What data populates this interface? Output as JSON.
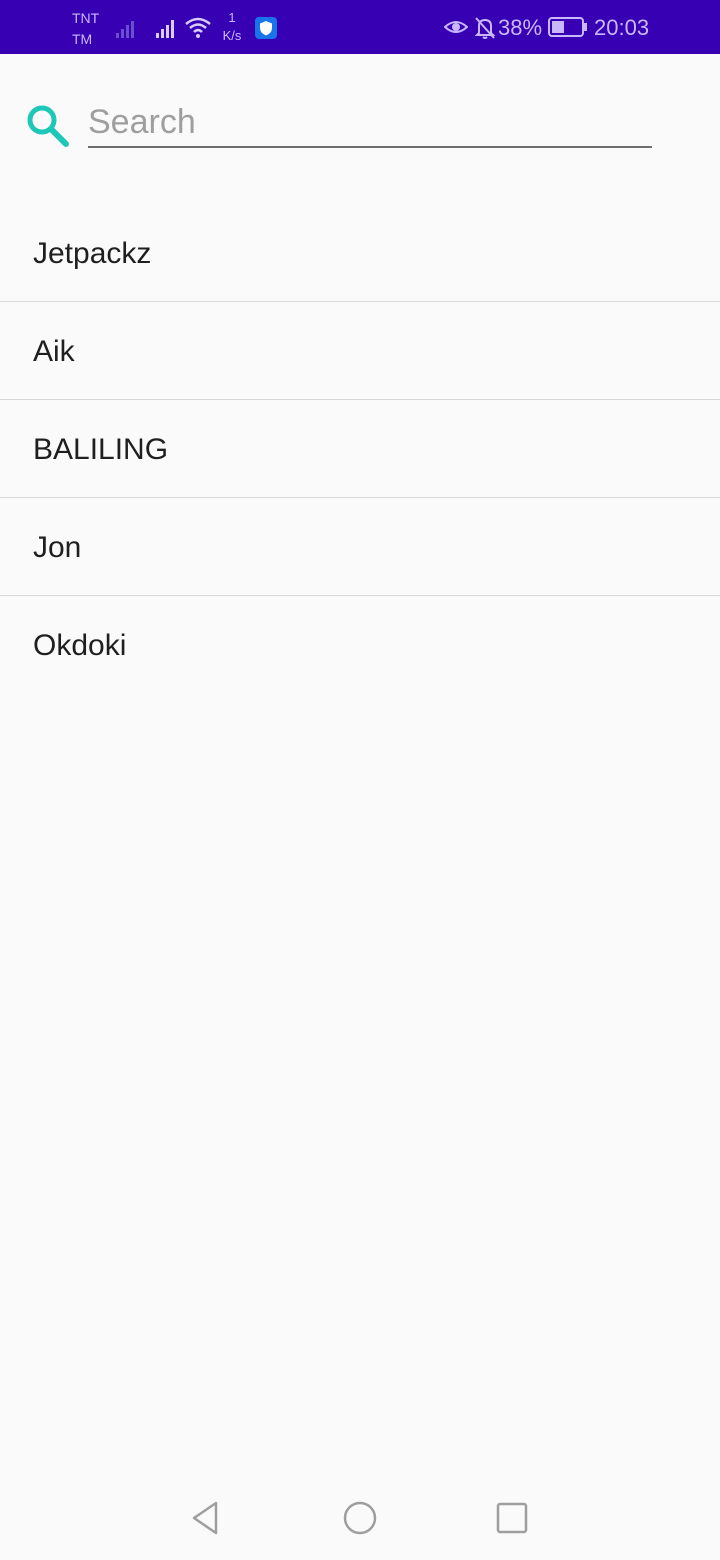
{
  "status_bar": {
    "carrier_line1": "TNT",
    "carrier_line2": "TM",
    "net_speed_value": "1",
    "net_speed_unit": "K/s",
    "battery_percent": "38%",
    "time": "20:03",
    "background": "#3700b3",
    "icons": [
      "signal-weak-icon",
      "signal-icon",
      "wifi-icon",
      "shield-app-icon",
      "eye-icon",
      "bell-off-icon",
      "battery-icon"
    ]
  },
  "search": {
    "placeholder": "Search",
    "value": "",
    "icon": "search-icon",
    "accent": "#1ec8b8"
  },
  "list": {
    "items": [
      {
        "label": "Jetpackz"
      },
      {
        "label": "Aik"
      },
      {
        "label": "BALILING"
      },
      {
        "label": "Jon"
      },
      {
        "label": "Okdoki"
      }
    ]
  },
  "nav_bar": {
    "icons": [
      "back-icon",
      "home-icon",
      "recents-icon"
    ]
  }
}
